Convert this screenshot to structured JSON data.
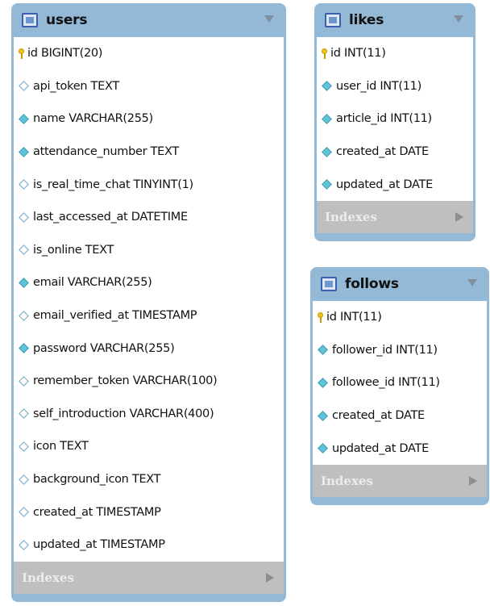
{
  "tables": {
    "users": {
      "name": "users",
      "indexes_label": "Indexes",
      "columns": [
        {
          "text": "id BIGINT(20)",
          "icon": "primary-key"
        },
        {
          "text": "api_token TEXT",
          "icon": "nullable-column"
        },
        {
          "text": "name VARCHAR(255)",
          "icon": "not-null-column"
        },
        {
          "text": "attendance_number TEXT",
          "icon": "not-null-column"
        },
        {
          "text": "is_real_time_chat TINYINT(1)",
          "icon": "nullable-column"
        },
        {
          "text": "last_accessed_at DATETIME",
          "icon": "nullable-column"
        },
        {
          "text": "is_online TEXT",
          "icon": "nullable-column"
        },
        {
          "text": "email VARCHAR(255)",
          "icon": "not-null-column"
        },
        {
          "text": "email_verified_at TIMESTAMP",
          "icon": "nullable-column"
        },
        {
          "text": "password VARCHAR(255)",
          "icon": "not-null-column"
        },
        {
          "text": "remember_token VARCHAR(100)",
          "icon": "nullable-column"
        },
        {
          "text": "self_introduction VARCHAR(400)",
          "icon": "nullable-column"
        },
        {
          "text": "icon TEXT",
          "icon": "nullable-column"
        },
        {
          "text": "background_icon TEXT",
          "icon": "nullable-column"
        },
        {
          "text": "created_at TIMESTAMP",
          "icon": "nullable-column"
        },
        {
          "text": "updated_at TIMESTAMP",
          "icon": "nullable-column"
        }
      ]
    },
    "likes": {
      "name": "likes",
      "indexes_label": "Indexes",
      "columns": [
        {
          "text": "id INT(11)",
          "icon": "primary-key"
        },
        {
          "text": "user_id INT(11)",
          "icon": "not-null-column"
        },
        {
          "text": "article_id INT(11)",
          "icon": "not-null-column"
        },
        {
          "text": "created_at DATE",
          "icon": "not-null-column"
        },
        {
          "text": "updated_at DATE",
          "icon": "not-null-column"
        }
      ]
    },
    "follows": {
      "name": "follows",
      "indexes_label": "Indexes",
      "columns": [
        {
          "text": "id INT(11)",
          "icon": "primary-key"
        },
        {
          "text": "follower_id INT(11)",
          "icon": "not-null-column"
        },
        {
          "text": "followee_id INT(11)",
          "icon": "not-null-column"
        },
        {
          "text": "created_at DATE",
          "icon": "not-null-column"
        },
        {
          "text": "updated_at DATE",
          "icon": "not-null-column"
        }
      ]
    }
  },
  "colors": {
    "header": "#93b9d6",
    "footer": "#bfbfbf",
    "pk": "#f2c21a",
    "column_diamond": "#5ec3d9"
  }
}
